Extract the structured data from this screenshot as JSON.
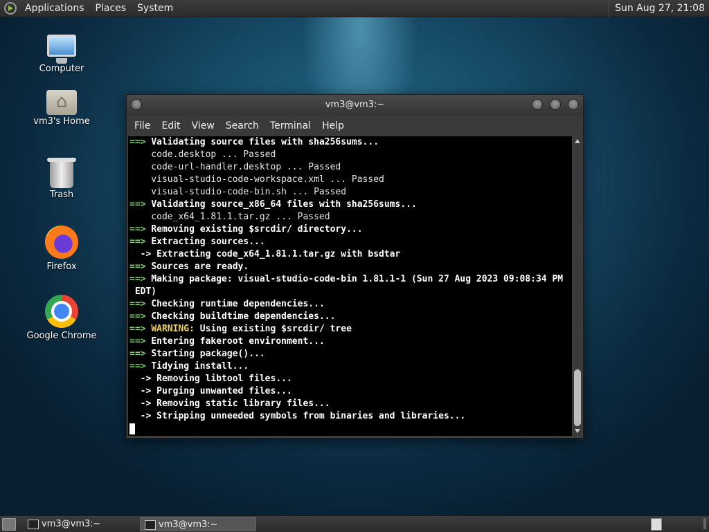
{
  "top_panel": {
    "menus": [
      "Applications",
      "Places",
      "System"
    ],
    "clock": "Sun Aug 27, 21:08"
  },
  "desktop_icons": [
    {
      "label": "Computer",
      "icon": "computer-icon"
    },
    {
      "label": "vm3's Home",
      "icon": "home-folder-icon"
    },
    {
      "label": "Trash",
      "icon": "trash-icon"
    },
    {
      "label": "Firefox",
      "icon": "firefox-icon"
    },
    {
      "label": "Google Chrome",
      "icon": "chrome-icon"
    }
  ],
  "terminal": {
    "title": "vm3@vm3:~",
    "menu": [
      "File",
      "Edit",
      "View",
      "Search",
      "Terminal",
      "Help"
    ],
    "lines": [
      {
        "prefix": "==>",
        "text": "Validating source files with sha256sums...",
        "style": "bold"
      },
      {
        "prefix": "",
        "text": "    code.desktop ... Passed",
        "style": "normal"
      },
      {
        "prefix": "",
        "text": "    code-url-handler.desktop ... Passed",
        "style": "normal"
      },
      {
        "prefix": "",
        "text": "    visual-studio-code-workspace.xml ... Passed",
        "style": "normal"
      },
      {
        "prefix": "",
        "text": "    visual-studio-code-bin.sh ... Passed",
        "style": "normal"
      },
      {
        "prefix": "==>",
        "text": "Validating source_x86_64 files with sha256sums...",
        "style": "bold"
      },
      {
        "prefix": "",
        "text": "    code_x64_1.81.1.tar.gz ... Passed",
        "style": "normal"
      },
      {
        "prefix": "==>",
        "text": "Removing existing $srcdir/ directory...",
        "style": "bold"
      },
      {
        "prefix": "==>",
        "text": "Extracting sources...",
        "style": "bold"
      },
      {
        "prefix": "",
        "text": "  -> Extracting code_x64_1.81.1.tar.gz with bsdtar",
        "style": "bold"
      },
      {
        "prefix": "==>",
        "text": "Sources are ready.",
        "style": "bold"
      },
      {
        "prefix": "==>",
        "text": "Making package: visual-studio-code-bin 1.81.1-1 (Sun 27 Aug 2023 09:08:34 PM",
        "style": "bold"
      },
      {
        "prefix": "",
        "text": " EDT)",
        "style": "bold"
      },
      {
        "prefix": "==>",
        "text": "Checking runtime dependencies...",
        "style": "bold"
      },
      {
        "prefix": "==>",
        "text": "Checking buildtime dependencies...",
        "style": "bold"
      },
      {
        "prefix": "==>",
        "text": "WARNING:",
        "rest": " Using existing $srcdir/ tree",
        "style": "warn"
      },
      {
        "prefix": "==>",
        "text": "Entering fakeroot environment...",
        "style": "bold"
      },
      {
        "prefix": "==>",
        "text": "Starting package()...",
        "style": "bold"
      },
      {
        "prefix": "==>",
        "text": "Tidying install...",
        "style": "bold"
      },
      {
        "prefix": "",
        "text": "  -> Removing libtool files...",
        "style": "bold"
      },
      {
        "prefix": "",
        "text": "  -> Purging unwanted files...",
        "style": "bold"
      },
      {
        "prefix": "",
        "text": "  -> Removing static library files...",
        "style": "bold"
      },
      {
        "prefix": "",
        "text": "  -> Stripping unneeded symbols from binaries and libraries...",
        "style": "bold"
      }
    ]
  },
  "taskbar": {
    "tasks": [
      {
        "label": "vm3@vm3:~",
        "active": false
      },
      {
        "label": "vm3@vm3:~",
        "active": true
      }
    ]
  }
}
